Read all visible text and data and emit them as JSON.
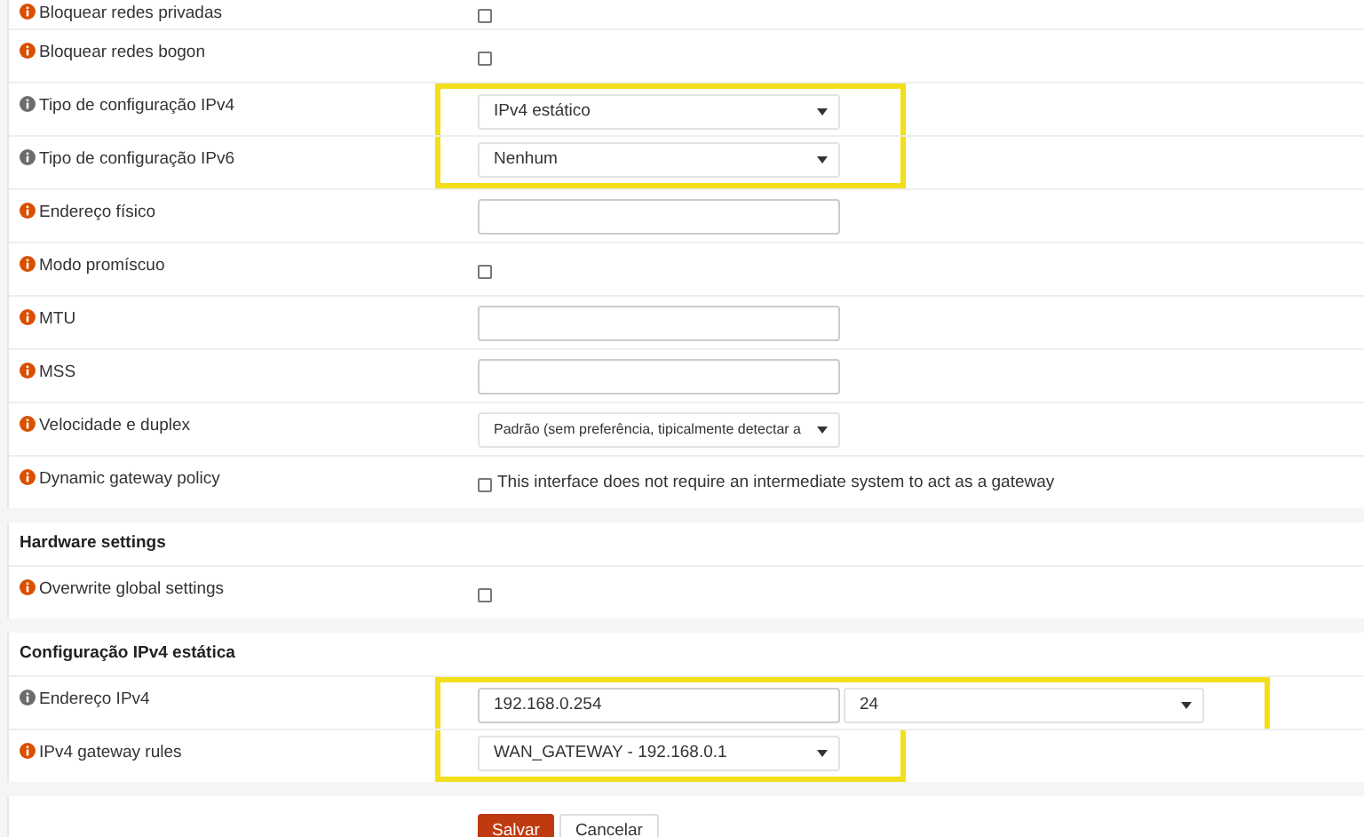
{
  "sections": [
    {
      "rows": [
        {
          "label": "Bloquear redes privadas",
          "color": "#d94f00",
          "kind": "checkbox",
          "checked": false,
          "highlighted": false
        },
        {
          "label": "Bloquear redes bogon",
          "color": "#d94f00",
          "kind": "checkbox",
          "checked": false,
          "highlighted": false
        },
        {
          "label": "Tipo de configuração IPv4",
          "color": "#6b6b6b",
          "kind": "select",
          "value": "IPv4 estático",
          "highlighted": true
        },
        {
          "label": "Tipo de configuração IPv6",
          "color": "#6b6b6b",
          "kind": "select",
          "value": "Nenhum",
          "highlighted": true
        },
        {
          "label": "Endereço físico",
          "color": "#d94f00",
          "kind": "text",
          "value": "",
          "highlighted": false
        },
        {
          "label": "Modo promíscuo",
          "color": "#d94f00",
          "kind": "checkbox",
          "checked": false,
          "highlighted": false
        },
        {
          "label": "MTU",
          "color": "#d94f00",
          "kind": "text",
          "highlighted": false
        },
        {
          "label": "MSS",
          "color": "#d94f00",
          "kind": "text",
          "highlighted": false
        },
        {
          "label": "Velocidade e duplex",
          "color": "#d94f00",
          "kind": "select",
          "value": "Padrão (sem preferência, tipicalmente detectar a",
          "highlighted": false
        },
        {
          "label": "Dynamic gateway policy",
          "color": "#d94f00",
          "kind": "checkbox",
          "checked": false,
          "text": "This interface does not require an intermediate system to act as a gateway",
          "highlighted": false
        }
      ]
    },
    {
      "title": "Hardware settings",
      "rows": [
        {
          "label": "Overwrite global settings",
          "color": "#d94f00",
          "kind": "checkbox",
          "checked": false,
          "highlighted": false
        }
      ]
    },
    {
      "title": "Configuração IPv4 estática",
      "rows": [
        {
          "label": "Endereço IPv4",
          "color": "#6b6b6b",
          "kind": "address",
          "value": "192.168.0.254",
          "mask": "24",
          "highlighted": true
        },
        {
          "label": "IPv4 gateway rules",
          "color": "#d94f00",
          "kind": "select",
          "value": "WAN_GATEWAY - 192.168.0.1",
          "highlighted": true
        }
      ]
    }
  ],
  "buttons": [
    {
      "label": "Salvar",
      "kind": "primary"
    },
    {
      "label": "Cancelar",
      "kind": "secondary"
    }
  ]
}
